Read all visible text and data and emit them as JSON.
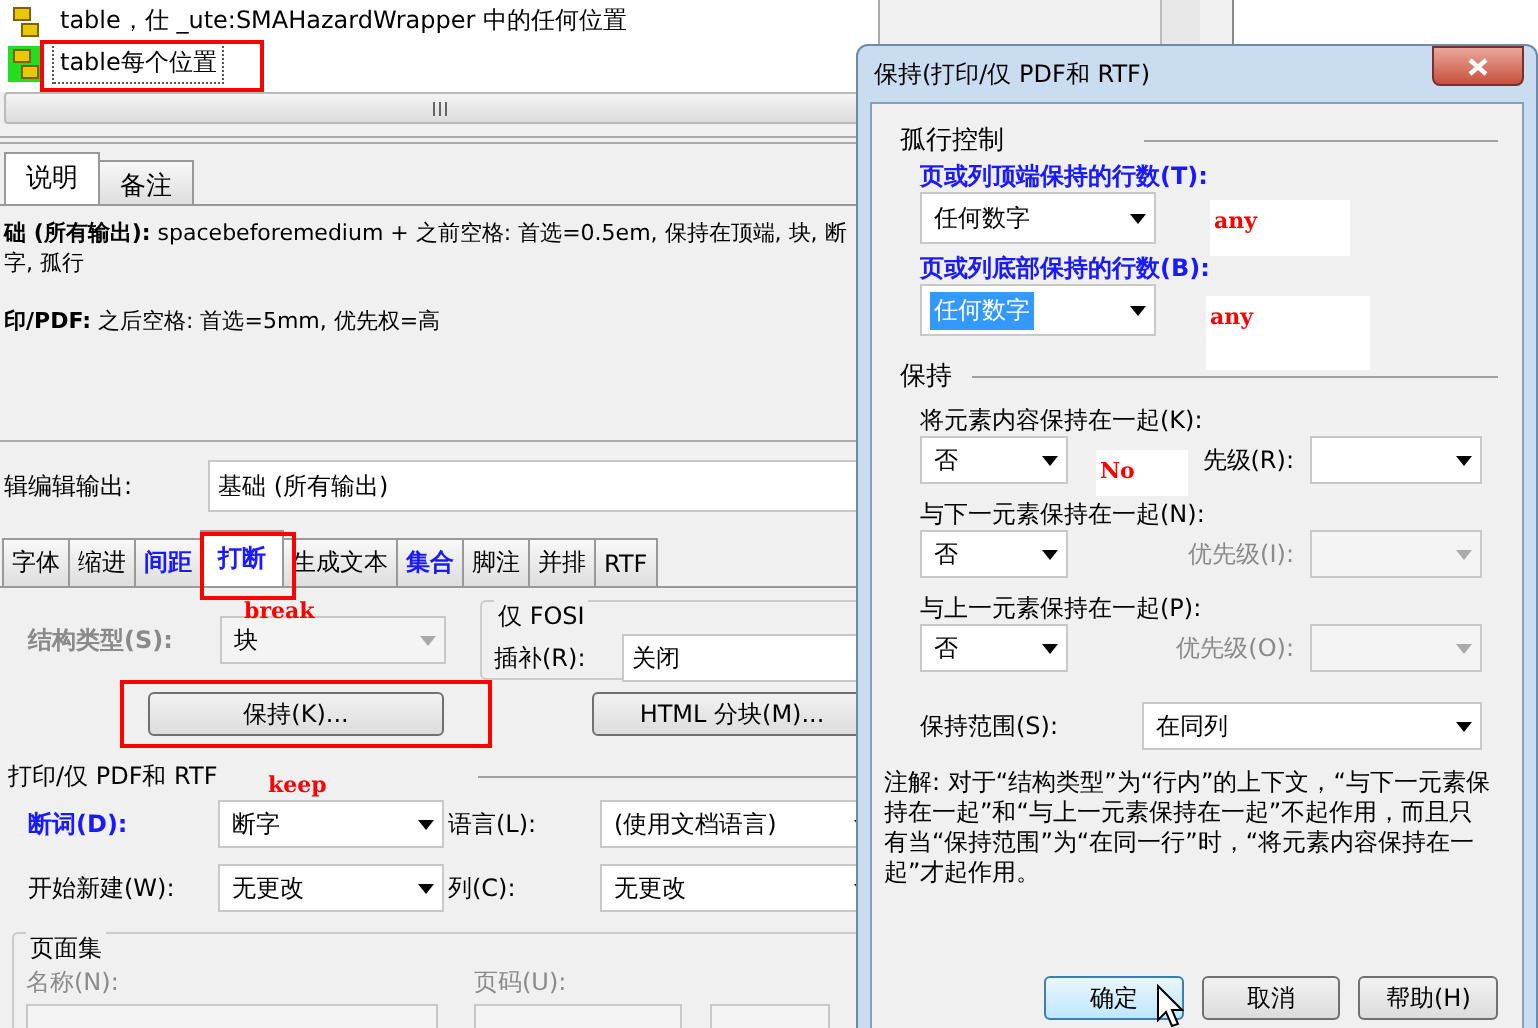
{
  "tree": [
    {
      "label": "table，仕 _ute:SMAHazardWrapper 中的任何位置",
      "selected": false
    },
    {
      "label": "table每个位置",
      "selected": true
    }
  ],
  "desc_tabs": [
    {
      "label": "说明",
      "selected": true
    },
    {
      "label": "备注",
      "selected": false
    }
  ],
  "description": [
    "**础 (所有输出):** spacebeforemedium + 之前空格: 首选=0.5em, 保持在顶端, 块, 断字, 孤行",
    "**印/PDF:** 之后空格: 首选=5mm, 优先权=高"
  ],
  "edit_output": {
    "label": "辑编辑输出:",
    "value": "基础 (所有输出)"
  },
  "property_tabs": [
    {
      "label": "字体",
      "selected": false,
      "modified": false
    },
    {
      "label": "缩进",
      "selected": false,
      "modified": false
    },
    {
      "label": "间距",
      "selected": false,
      "modified": true
    },
    {
      "label": "打断",
      "selected": true,
      "modified": true
    },
    {
      "label": "生成文本",
      "selected": false,
      "modified": false
    },
    {
      "label": "集合",
      "selected": false,
      "modified": true
    },
    {
      "label": "脚注",
      "selected": false,
      "modified": false
    },
    {
      "label": "并排",
      "selected": false,
      "modified": false
    },
    {
      "label": "RTF",
      "selected": false,
      "modified": false
    }
  ],
  "structure_type": {
    "label": "结构类型(S):",
    "value": "块",
    "disabled": true
  },
  "fosi": {
    "title": "仅 FOSI",
    "label": "插补(R):",
    "value": "关闭"
  },
  "buttons": [
    "保持(K)...",
    "HTML 分块(M)..."
  ],
  "print_group": {
    "title": "打印/仅 PDF和 RTF",
    "fields": [
      {
        "label": "断词(D):",
        "value": "断字",
        "modified": true
      },
      {
        "label": "语言(L):",
        "value": "(使用文档语言)",
        "modified": false
      },
      {
        "label": "开始新建(W):",
        "value": "无更改",
        "modified": false
      },
      {
        "label": "列(C):",
        "value": "无更改",
        "modified": false
      }
    ]
  },
  "page_set": {
    "title": "页面集",
    "fields": [
      {
        "label": "名称(N):",
        "disabled": true
      },
      {
        "label": "页码(U):",
        "disabled": true
      }
    ]
  },
  "dialog": {
    "title": "保持(打印/仅 PDF和 RTF)",
    "orphan_group": {
      "title": "孤行控制",
      "fields": [
        {
          "label": "页或列顶端保持的行数(T):",
          "value": "任何数字",
          "modified": true,
          "selected": false
        },
        {
          "label": "页或列底部保持的行数(B):",
          "value": "任何数字",
          "modified": true,
          "selected": true
        }
      ]
    },
    "keep_group": {
      "title": "保持",
      "rows": [
        {
          "label": "将元素内容保持在一起(K):",
          "value": "否",
          "priority_label": "先级(R):",
          "priority_disabled": false
        },
        {
          "label": "与下一元素保持在一起(N):",
          "value": "否",
          "priority_label": "优先级(I):",
          "priority_disabled": true
        },
        {
          "label": "与上一元素保持在一起(P):",
          "value": "否",
          "priority_label": "优先级(O):",
          "priority_disabled": true
        }
      ],
      "scope": {
        "label": "保持范围(S):",
        "value": "在同列"
      }
    },
    "note": "注解: 对于“结构类型”为“行内”的上下文，“与下一元素保持在一起”和“与上一元素保持在一起”不起作用，而且只有当“保持范围”为“在同一行”时，“将元素内容保持在一起”才起作用。",
    "buttons": [
      {
        "label": "确定",
        "focused": true
      },
      {
        "label": "取消",
        "focused": false
      },
      {
        "label": "帮助(H)",
        "focused": false
      }
    ]
  },
  "annotations": [
    {
      "text": "break"
    },
    {
      "text": "keep"
    },
    {
      "text": "any"
    },
    {
      "text": "any"
    },
    {
      "text": "No"
    }
  ]
}
